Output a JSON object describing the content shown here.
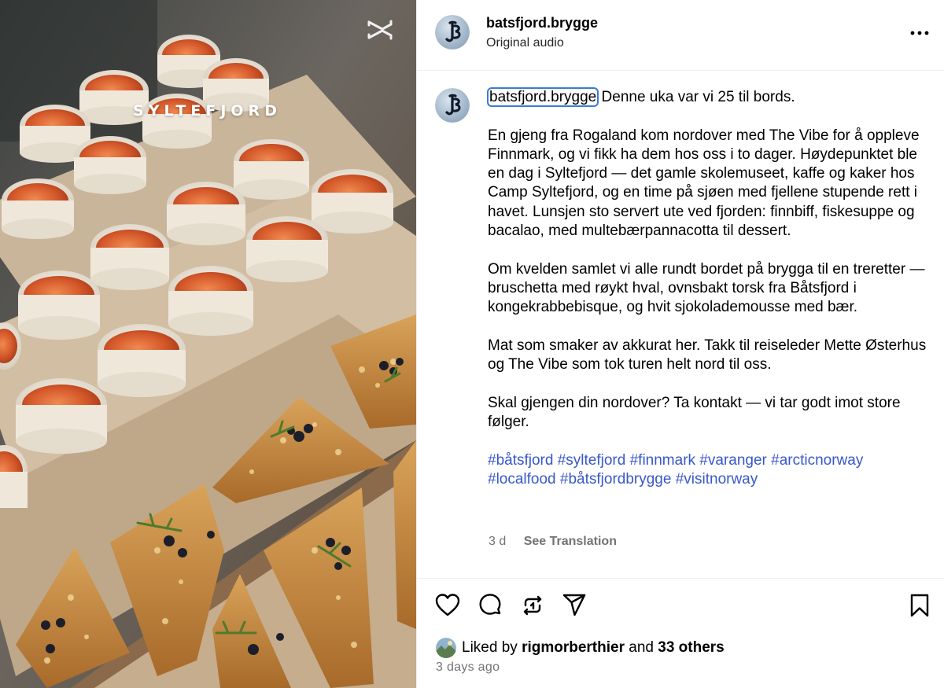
{
  "media": {
    "overlay_title": "SYLTEFJORD",
    "edit_icon": "capcut-icon"
  },
  "header": {
    "username": "batsfjord.brygge",
    "audio": "Original audio",
    "more_icon": "more-horizontal-icon"
  },
  "caption": {
    "username": "batsfjord.brygge",
    "paragraphs": [
      "Denne uka var vi 25 til bords.",
      "En gjeng fra Rogaland kom nordover med The Vibe for å oppleve Finnmark, og vi fikk ha dem hos oss i to dager. Høydepunktet ble en dag i Syltefjord — det gamle skolemuseet, kaffe og kaker hos Camp Syltefjord, og en time på sjøen med fjellene stupende rett i havet. Lunsjen sto servert ute ved fjorden: finnbiff, fiskesuppe og bacalao, med multebærpannacotta til dessert.",
      "Om kvelden samlet vi alle rundt bordet på brygga til en treretter — bruschetta med røykt hval, ovnsbakt torsk fra Båtsfjord i kongekrabbebisque, og hvit sjokolademousse med bær.",
      "Mat som smaker av akkurat her. Takk til reiseleder Mette Østerhus og The Vibe som tok turen helt nord til oss.",
      "Skal gjengen din nordover? Ta kontakt — vi tar godt imot store følger."
    ],
    "hashtags": "#båtsfjord #syltefjord #finnmark #varanger #arcticnorway #localfood #båtsfjordbrygge #visitnorway",
    "age": "3 d",
    "see_translation": "See Translation"
  },
  "actions": {
    "icons": [
      "heart-icon",
      "comment-icon",
      "repost-icon",
      "share-icon",
      "bookmark-icon"
    ],
    "liked_prefix": "Liked by",
    "liked_user": "rigmorberthier",
    "liked_and": "and",
    "liked_others": "33 others",
    "posted": "3 days ago"
  },
  "colors": {
    "link": "#3858c9",
    "secondary_text": "#737373",
    "divider": "#efefef",
    "focus_outline": "#3a7bd5"
  }
}
